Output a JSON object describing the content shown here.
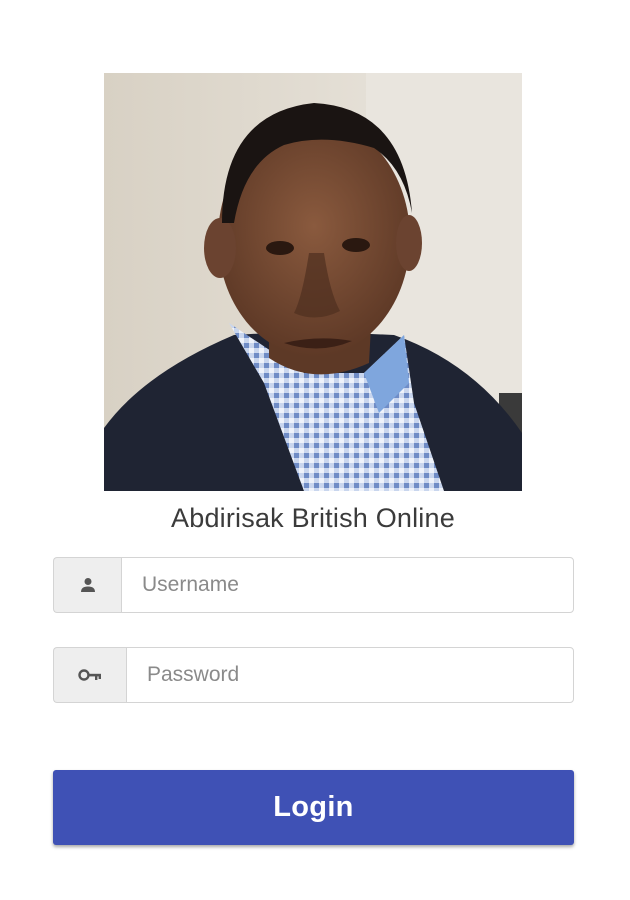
{
  "profile": {
    "photo_icon": "portrait-photo",
    "title": "Abdirisak British Online"
  },
  "form": {
    "username": {
      "icon": "user-icon",
      "placeholder": "Username",
      "value": ""
    },
    "password": {
      "icon": "key-icon",
      "placeholder": "Password",
      "value": ""
    },
    "login_label": "Login"
  },
  "colors": {
    "primary": "#3f51b5",
    "addon_bg": "#eeeeee",
    "border": "#d4d4d4",
    "title_text": "#3b3b3b"
  }
}
